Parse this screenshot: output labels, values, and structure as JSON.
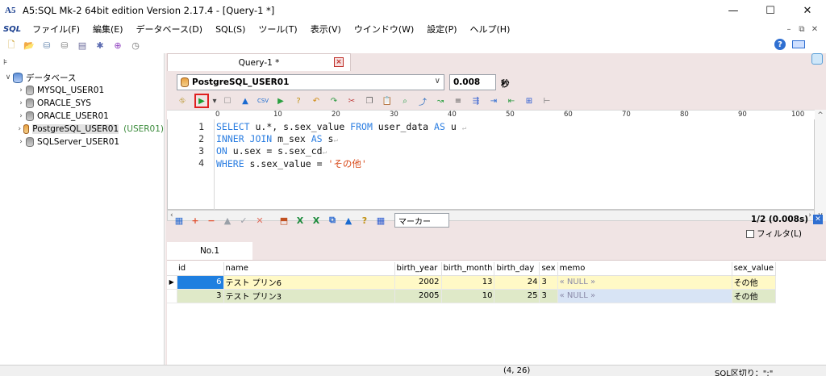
{
  "window": {
    "title": "A5:SQL Mk-2 64bit edition Version 2.17.4 - [Query-1 *]",
    "minimize": "—",
    "maximize": "☐",
    "close": "✕"
  },
  "menu": {
    "sql_icon": "SQL",
    "items": [
      "ファイル(F)",
      "編集(E)",
      "データベース(D)",
      "SQL(S)",
      "ツール(T)",
      "表示(V)",
      "ウインドウ(W)",
      "設定(P)",
      "ヘルプ(H)"
    ]
  },
  "tree": {
    "root": "データベース",
    "items": [
      {
        "label": "MYSQL_USER01"
      },
      {
        "label": "ORACLE_SYS"
      },
      {
        "label": "ORACLE_USER01"
      },
      {
        "label": "PostgreSQL_USER01",
        "user": "(USER01)"
      },
      {
        "label": "SQLServer_USER01"
      }
    ]
  },
  "doc_tab": {
    "label": "Query-1 *"
  },
  "query": {
    "connection": "PostgreSQL_USER01",
    "elapsed": "0.008",
    "elapsed_unit": "秒"
  },
  "ruler": {
    "marks": [
      "0",
      "10",
      "20",
      "30",
      "40",
      "50",
      "60",
      "70",
      "80",
      "90",
      "100"
    ]
  },
  "editor": {
    "line_numbers": [
      "1",
      "2",
      "3",
      "4"
    ]
  },
  "result": {
    "marker_placeholder": "マーカー",
    "row_count": "1/2 (0.008s)",
    "filter_label": "フィルタ(L)",
    "tab_label": "No.1",
    "columns": [
      "id",
      "name",
      "birth_year",
      "birth_month",
      "birth_day",
      "sex",
      "memo",
      "sex_value"
    ],
    "rows": [
      [
        "6",
        "テスト プリン6",
        "2002",
        "13",
        "24",
        "3",
        "« NULL »",
        "その他"
      ],
      [
        "3",
        "テスト プリン3",
        "2005",
        "10",
        "25",
        "3",
        "« NULL »",
        "その他"
      ]
    ]
  },
  "status": {
    "position": "(4, 26)",
    "separator": "SQL区切り：\";\""
  }
}
